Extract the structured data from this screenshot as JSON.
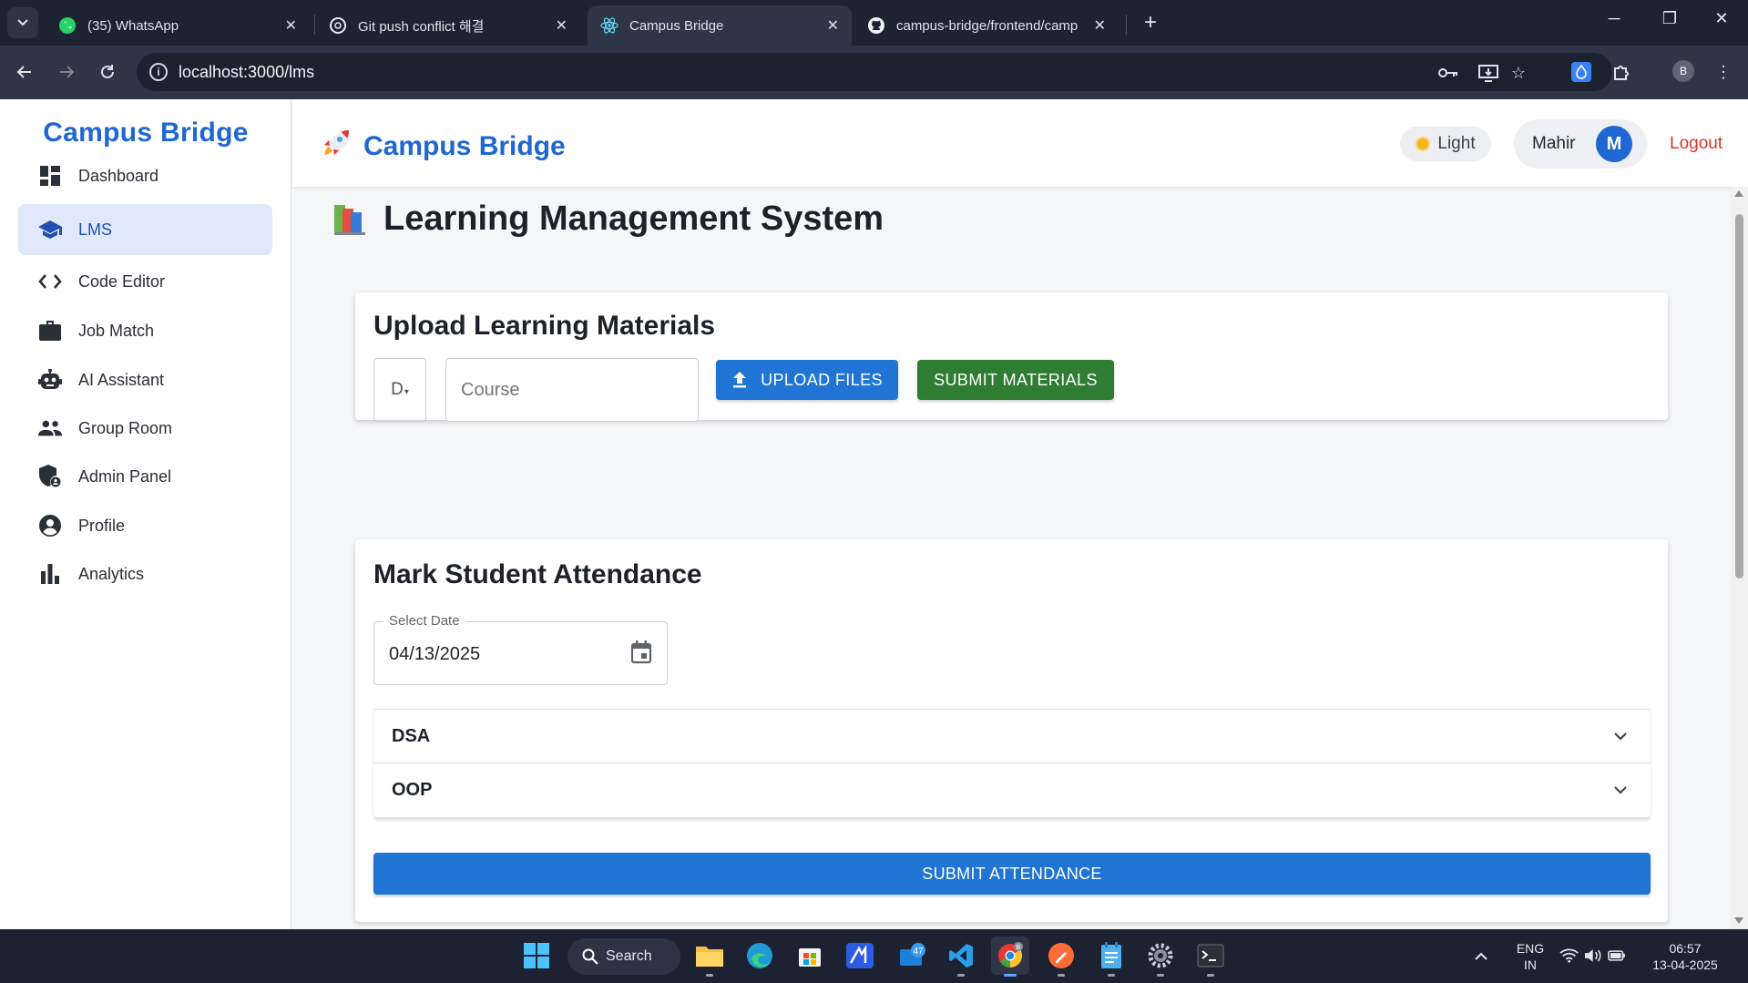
{
  "browser": {
    "tabs": [
      {
        "title": "(35) WhatsApp",
        "icon": "whatsapp-icon"
      },
      {
        "title": "Git push conflict 해결",
        "icon": "chatgpt-icon"
      },
      {
        "title": "Campus Bridge",
        "icon": "react-icon"
      },
      {
        "title": "campus-bridge/frontend/camp",
        "icon": "github-icon"
      }
    ],
    "active_tab": 2,
    "url": "localhost:3000/lms",
    "profile_initial": "B"
  },
  "sidebar": {
    "brand": "Campus Bridge",
    "items": [
      {
        "label": "Dashboard",
        "icon": "dashboard-icon"
      },
      {
        "label": "LMS",
        "icon": "school-icon"
      },
      {
        "label": "Code Editor",
        "icon": "code-icon"
      },
      {
        "label": "Job Match",
        "icon": "briefcase-icon"
      },
      {
        "label": "AI Assistant",
        "icon": "robot-icon"
      },
      {
        "label": "Group Room",
        "icon": "group-icon"
      },
      {
        "label": "Admin Panel",
        "icon": "admin-icon"
      },
      {
        "label": "Profile",
        "icon": "profile-icon"
      },
      {
        "label": "Analytics",
        "icon": "analytics-icon"
      }
    ],
    "active_index": 1
  },
  "topbar": {
    "brand": "Campus Bridge",
    "theme_label": "Light",
    "user_name": "Mahir",
    "avatar_initial": "M",
    "logout_label": "Logout"
  },
  "main": {
    "title": "Learning Management System",
    "upload": {
      "title": "Upload Learning Materials",
      "select_value": "D",
      "course_placeholder": "Course",
      "upload_label": "UPLOAD FILES",
      "submit_label": "SUBMIT MATERIALS"
    },
    "attendance": {
      "title": "Mark Student Attendance",
      "date_label": "Select Date",
      "date_value": "04/13/2025",
      "courses": [
        "DSA",
        "OOP"
      ],
      "submit_label": "SUBMIT ATTENDANCE"
    }
  },
  "taskbar": {
    "search_label": "Search",
    "mail_badge": "47",
    "lang_line1": "ENG",
    "lang_line2": "IN",
    "time": "06:57",
    "date": "13-04-2025"
  },
  "colors": {
    "brand_blue": "#1f67d2",
    "button_blue": "#1f74d4",
    "button_green": "#2e7d32",
    "logout_red": "#d9342b",
    "active_nav_bg": "#dfe9fb"
  }
}
